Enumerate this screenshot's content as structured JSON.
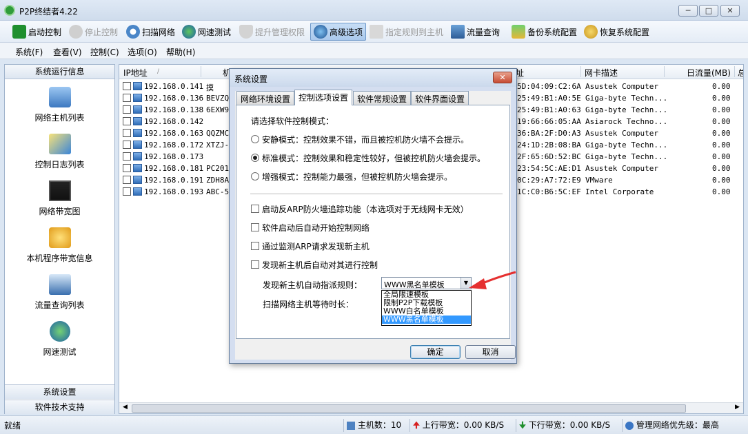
{
  "window": {
    "title": "P2P终结者4.22"
  },
  "toolbar": {
    "start": "启动控制",
    "stop": "停止控制",
    "scan": "扫描网络",
    "speedtest": "网速测试",
    "elevate": "提升管理权限",
    "advanced": "高级选项",
    "assign_rule": "指定规则到主机",
    "traffic": "流量查询",
    "backup": "备份系统配置",
    "restore": "恢复系统配置"
  },
  "menu": [
    "系统(F)",
    "查看(V)",
    "控制(C)",
    "选项(O)",
    "帮助(H)"
  ],
  "sidebar": {
    "header": "系统运行信息",
    "items": [
      "网络主机列表",
      "控制日志列表",
      "网络带宽图",
      "本机程序带宽信息",
      "流量查询列表",
      "网速测试"
    ],
    "footer1": "系统设置",
    "footer2": "软件技术支持"
  },
  "table": {
    "columns": [
      "IP地址",
      "机",
      "址",
      "网卡描述",
      "日流量(MB)",
      "总"
    ],
    "rows": [
      {
        "ip": "192.168.0.141",
        "name": "摸",
        "mac": "5D:04:09:C2:6A",
        "vendor": "Asustek Computer",
        "traffic": "0.00"
      },
      {
        "ip": "192.168.0.136",
        "name": "BEVZQK",
        "mac": "25:49:B1:A0:5E",
        "vendor": "Giga-byte Techn...",
        "traffic": "0.00"
      },
      {
        "ip": "192.168.0.138",
        "name": "6EXW9E",
        "mac": "25:49:B1:A0:63",
        "vendor": "Giga-byte Techn...",
        "traffic": "0.00"
      },
      {
        "ip": "192.168.0.142",
        "name": "",
        "mac": "19:66:66:05:AA",
        "vendor": "Asiarock Techno...",
        "traffic": "0.00"
      },
      {
        "ip": "192.168.0.163",
        "name": "QQZMCN",
        "mac": "36:BA:2F:D0:A3",
        "vendor": "Asustek Computer",
        "traffic": "0.00"
      },
      {
        "ip": "192.168.0.172",
        "name": "XTZJ-",
        "mac": "24:1D:2B:08:BA",
        "vendor": "Giga-byte Techn...",
        "traffic": "0.00"
      },
      {
        "ip": "192.168.0.173",
        "name": "",
        "mac": "2F:65:6D:52:BC",
        "vendor": "Giga-byte Techn...",
        "traffic": "0.00"
      },
      {
        "ip": "192.168.0.181",
        "name": "PC2012",
        "mac": "23:54:5C:AE:D1",
        "vendor": "Asustek Computer",
        "traffic": "0.00"
      },
      {
        "ip": "192.168.0.191",
        "name": "ZDH8A3",
        "mac": "0C:29:A7:72:E9",
        "vendor": "VMware",
        "traffic": "0.00"
      },
      {
        "ip": "192.168.0.193",
        "name": "ABC-5E",
        "mac": "1C:C0:B6:5C:EF",
        "vendor": "Intel Corporate",
        "traffic": "0.00"
      }
    ]
  },
  "status": {
    "ready": "就绪",
    "hosts": "主机数：10",
    "up": "上行带宽：0.00 KB/S",
    "down": "下行带宽：0.00 KB/S",
    "priority": "管理网络优先级：最高"
  },
  "dialog": {
    "title": "系统设置",
    "tabs": [
      "网络环境设置",
      "控制选项设置",
      "软件常规设置",
      "软件界面设置"
    ],
    "prompt": "请选择软件控制模式：",
    "modes": [
      "安静模式：控制效果不错，而且被控机防火墙不会提示。",
      "标准模式：控制效果和稳定性较好，但被控机防火墙会提示。",
      "增强模式：控制能力最强，但被控机防火墙会提示。"
    ],
    "options": [
      "启动反ARP防火墙追踪功能（本选项对于无线网卡无效）",
      "软件启动后自动开始控制网络",
      "通过监测ARP请求发现新主机",
      "发现新主机后自动对其进行控制"
    ],
    "assign_label": "发现新主机自动指派规则：",
    "scan_wait_label": "扫描网络主机等待时长：",
    "combo_value": "WWW黑名单模板",
    "combo_options": [
      "全局限速模板",
      "限制P2P下载模板",
      "WWW白名单模板",
      "WWW黑名单模板"
    ],
    "ok": "确定",
    "cancel": "取消"
  },
  "colors": {
    "accent": "#3399ff",
    "arrow": "#e53030"
  }
}
